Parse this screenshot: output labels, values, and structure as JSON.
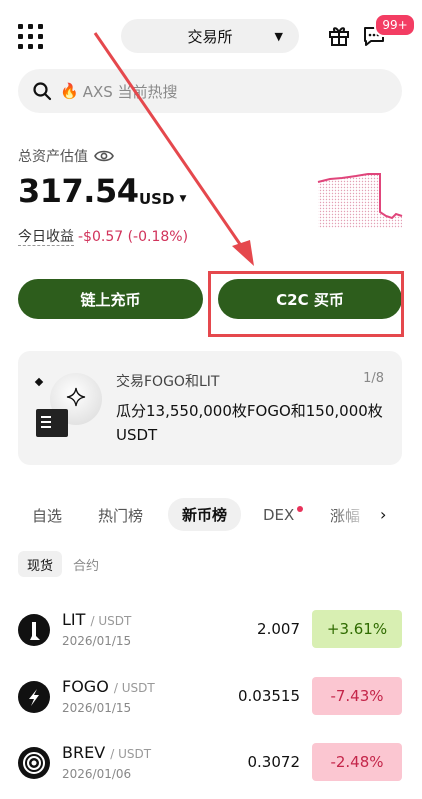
{
  "header": {
    "mode_label": "交易所",
    "notification_badge": "99+"
  },
  "search": {
    "placeholder": "AXS 当前热搜"
  },
  "assets": {
    "label": "总资产估值",
    "balance": "317.54",
    "currency": "USD",
    "pnl_label": "今日收益",
    "pnl_value": "-$0.57 (-0.18%)"
  },
  "actions": {
    "onchain_deposit": "链上充币",
    "c2c_buy": "C2C 买币"
  },
  "banner": {
    "title": "交易FOGO和LIT",
    "page": "1/8",
    "description": "瓜分13,550,000枚FOGO和150,000枚USDT"
  },
  "market_tabs": [
    "自选",
    "热门榜",
    "新币榜",
    "DEX",
    "涨幅"
  ],
  "sub_tabs": [
    "现货",
    "合约"
  ],
  "coins": [
    {
      "symbol": "LIT",
      "quote": "/ USDT",
      "date": "2026/01/15",
      "price": "2.007",
      "change": "+3.61%",
      "direction": "up"
    },
    {
      "symbol": "FOGO",
      "quote": "/ USDT",
      "date": "2026/01/15",
      "price": "0.03515",
      "change": "-7.43%",
      "direction": "down"
    },
    {
      "symbol": "BREV",
      "quote": "/ USDT",
      "date": "2026/01/06",
      "price": "0.3072",
      "change": "-2.48%",
      "direction": "down"
    }
  ],
  "colors": {
    "primary_green": "#2d5d1c",
    "up_bg": "#d8efb2",
    "down_bg": "#fbc6d1",
    "annotation_red": "#e5484d",
    "badge_red": "#f33d63"
  }
}
